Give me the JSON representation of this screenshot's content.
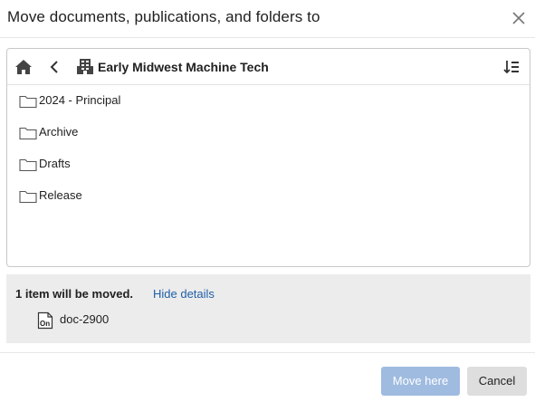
{
  "dialog": {
    "title": "Move documents, publications, and folders to"
  },
  "browser": {
    "breadcrumb": "Early Midwest Machine Tech",
    "folders": [
      {
        "label": "2024 - Principal"
      },
      {
        "label": "Archive"
      },
      {
        "label": "Drafts"
      },
      {
        "label": "Release"
      }
    ]
  },
  "details": {
    "count_text": "1 item will be moved.",
    "toggle_label": "Hide details",
    "items": [
      {
        "name": "doc-2900",
        "icon": "onshape-document-icon"
      }
    ]
  },
  "footer": {
    "move_label": "Move here",
    "cancel_label": "Cancel"
  },
  "colors": {
    "link": "#1f5fa8",
    "primary_disabled": "#9fbbe0",
    "details_bg": "#ececec",
    "secondary_bg": "#dedede"
  }
}
